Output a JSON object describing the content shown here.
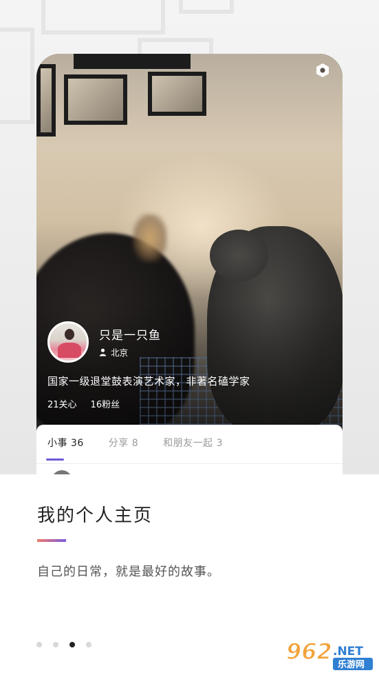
{
  "profile": {
    "username": "只是一只鱼",
    "location": "北京",
    "bio": "国家一级退堂鼓表演艺术家，非著名磕学家",
    "stats": {
      "following": "21关心",
      "followers": "16粉丝"
    }
  },
  "tabs": [
    {
      "label": "小事 36",
      "active": true
    },
    {
      "label": "分享 8",
      "active": false
    },
    {
      "label": "和朋友一起 3",
      "active": false
    }
  ],
  "card": {
    "title": "我的个人主页",
    "subtitle": "自己的日常，就是最好的故事。"
  },
  "pagination": {
    "total": 4,
    "current": 3
  },
  "watermark": {
    "number": "962",
    "suffix": ".NET",
    "site": "乐游网"
  },
  "colors": {
    "accent_start": "#f07a6a",
    "accent_end": "#7b5be0",
    "tab_indicator": "#6b5bd6"
  }
}
